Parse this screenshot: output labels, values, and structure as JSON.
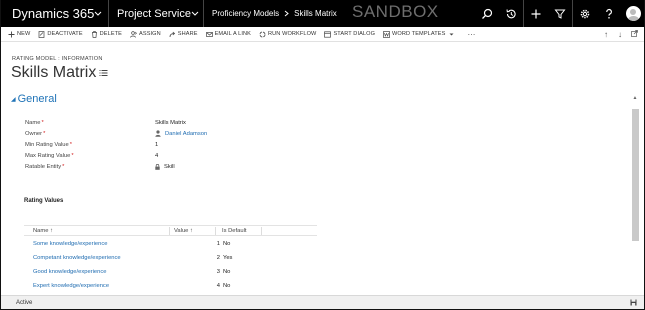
{
  "topbar": {
    "app_name": "Dynamics 365",
    "module": "Project Service",
    "breadcrumb_entity": "Proficiency Models",
    "breadcrumb_record": "Skills Matrix",
    "environment_label": "SANDBOX",
    "icons": [
      "search-icon",
      "history-icon",
      "plus-icon",
      "filter-icon",
      "gear-icon",
      "help-icon",
      "avatar"
    ]
  },
  "command_bar": {
    "new": "NEW",
    "deactivate": "DEACTIVATE",
    "delete": "DELETE",
    "assign": "ASSIGN",
    "share": "SHARE",
    "email_link": "EMAIL A LINK",
    "run_workflow": "RUN WORKFLOW",
    "start_dialog": "START DIALOG",
    "word_templates": "WORD TEMPLATES",
    "more": "···"
  },
  "header": {
    "record_type": "RATING MODEL : INFORMATION",
    "title": "Skills Matrix"
  },
  "section": {
    "title": "General",
    "fields": [
      {
        "label": "Name",
        "required": true,
        "value": "Skills Matrix"
      },
      {
        "label": "Owner",
        "required": true,
        "value": "Daniel Adamson"
      },
      {
        "label": "Min Rating Value",
        "required": true,
        "value": "1"
      },
      {
        "label": "Max Rating Value",
        "required": true,
        "value": "4"
      },
      {
        "label": "Ratable Entity",
        "required": true,
        "value": "Skill"
      }
    ]
  },
  "subgrid": {
    "title": "Rating Values",
    "columns": [
      "Name ↑",
      "Value ↑",
      "Is Default"
    ],
    "rows": [
      {
        "name": "Some knowledge/experience",
        "value": "1",
        "is_default": "No"
      },
      {
        "name": "Competant knowledge/experience",
        "value": "2",
        "is_default": "Yes"
      },
      {
        "name": "Good knowledge/experience",
        "value": "3",
        "is_default": "No"
      },
      {
        "name": "Expert knowledge/experience",
        "value": "4",
        "is_default": "No"
      }
    ]
  },
  "footer": {
    "status": "Active"
  },
  "colors": {
    "topbar": "#000000",
    "link": "#1f6cb1",
    "section_title": "#1f73b7",
    "required": "#d21f1f"
  }
}
